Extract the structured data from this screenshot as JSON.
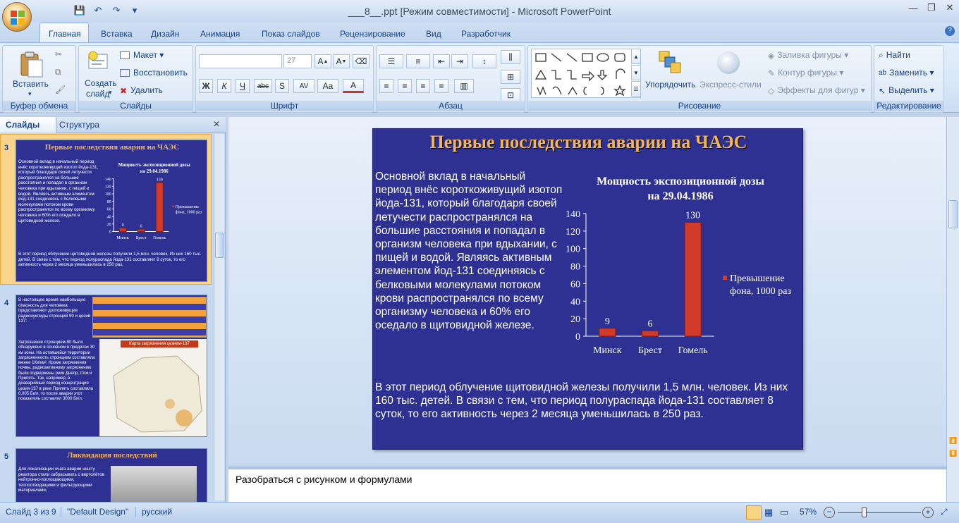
{
  "window": {
    "title": "___8__.ppt [Режим совместимости] - Microsoft PowerPoint",
    "minimize": "—",
    "restore": "❐",
    "close": "✕"
  },
  "qat": {
    "save": "💾",
    "undo": "↶",
    "redo": "↷",
    "more": "▾"
  },
  "tabs": [
    "Главная",
    "Вставка",
    "Дизайн",
    "Анимация",
    "Показ слайдов",
    "Рецензирование",
    "Вид",
    "Разработчик"
  ],
  "help": "?",
  "ribbon": {
    "clipboard": {
      "label": "Буфер обмена",
      "paste": "Вставить"
    },
    "slides": {
      "label": "Слайды",
      "new_slide": "Создать",
      "new_slide2": "слайд",
      "layout": "Макет",
      "reset": "Восстановить",
      "delete": "Удалить"
    },
    "font": {
      "label": "Шрифт",
      "font_name": "",
      "font_size": "27",
      "bold": "Ж",
      "italic": "К",
      "underline": "Ч",
      "strike": "abc",
      "shadow": "S",
      "spacing": "AV",
      "case": "Aa",
      "color": "A"
    },
    "paragraph": {
      "label": "Абзац"
    },
    "drawing": {
      "label": "Рисование",
      "arrange": "Упорядочить",
      "quick_styles": "Экспресс-стили",
      "fill": "Заливка фигуры",
      "outline": "Контур фигуры",
      "effects": "Эффекты для фигур"
    },
    "editing": {
      "label": "Редактирование",
      "find": "Найти",
      "replace": "Заменить",
      "select": "Выделить"
    }
  },
  "panel": {
    "tab_slides": "Слайды",
    "tab_outline": "Структура",
    "close": "✕"
  },
  "thumbs": {
    "t3": {
      "num": "3",
      "title": "Первые последствия аварии на ЧАЭС"
    },
    "t4": {
      "num": "4",
      "text1": "В настоящее время наибольшую опасность для человека представляют долгоживущие радионуклиды стронций 90 и цезий 137:",
      "map_title": "Карта загрязнения цезием-137",
      "text2": "Загрязнение стронцием-90 было обнаружено в основном в пределах 30 км зоны. На оставшейся территории загрязненность стронцием составляла менее 1Ки/км². Кроме загрязнения почвы, радиоактивному загрязнению были подвержены реки Днепр, Сож и Припять. Так, например, в доаварийный период концентрация цезия-137 в реке Припять составляла 0,005 Бк/л, то после аварии этот показатель составлял 3000 Бк/л."
    },
    "t5": {
      "num": "5",
      "title": "Ликвидация последствий",
      "text": "Для локализации очага аварии шахту реактора стали забрасывать с вертолётов нейтронно-поглощающими, теплоотводящими и фильтрующими материалами,"
    }
  },
  "slide": {
    "title": "Первые последствия аварии на ЧАЭС",
    "body": "Основной вклад в начальный период внёс короткоживущий изотоп йода-131, который благодаря своей летучести распространялся на большие расстояния и попадал в организм человека при вдыхании, с пищей и водой. Являясь активным элементом йод-131 соединяясь с белковыми молекулами потоком крови распространялся по всему организму человека  и 60% его оседало в щитовидной железе.",
    "bottom": "В этот период облучение щитовидной железы получили 1,5 млн. человек.  Из них 160 тыс. детей. В связи с тем, что период полураспада йода-131 составляет 8 суток, то его активность через 2 месяца уменьшилась в 250 раз."
  },
  "chart_data": {
    "type": "bar",
    "title": "Мощность экспозиционной дозы на 29.04.1986",
    "categories": [
      "Минск",
      "Брест",
      "Гомель"
    ],
    "series": [
      {
        "name": "Превышение фона, 1000 раз",
        "values": [
          9,
          6,
          130
        ]
      }
    ],
    "yticks": [
      0,
      20,
      40,
      60,
      80,
      100,
      120,
      140
    ],
    "ylim": [
      0,
      140
    ],
    "legend": "right",
    "bar_color": "#d23a2a"
  },
  "notes": {
    "text": "Разобраться с рисунком и формулами"
  },
  "status": {
    "slide": "Слайд 3 из 9",
    "design": "\"Default Design\"",
    "lang": "русский",
    "zoom": "57%",
    "zoom_level": 0.57
  }
}
